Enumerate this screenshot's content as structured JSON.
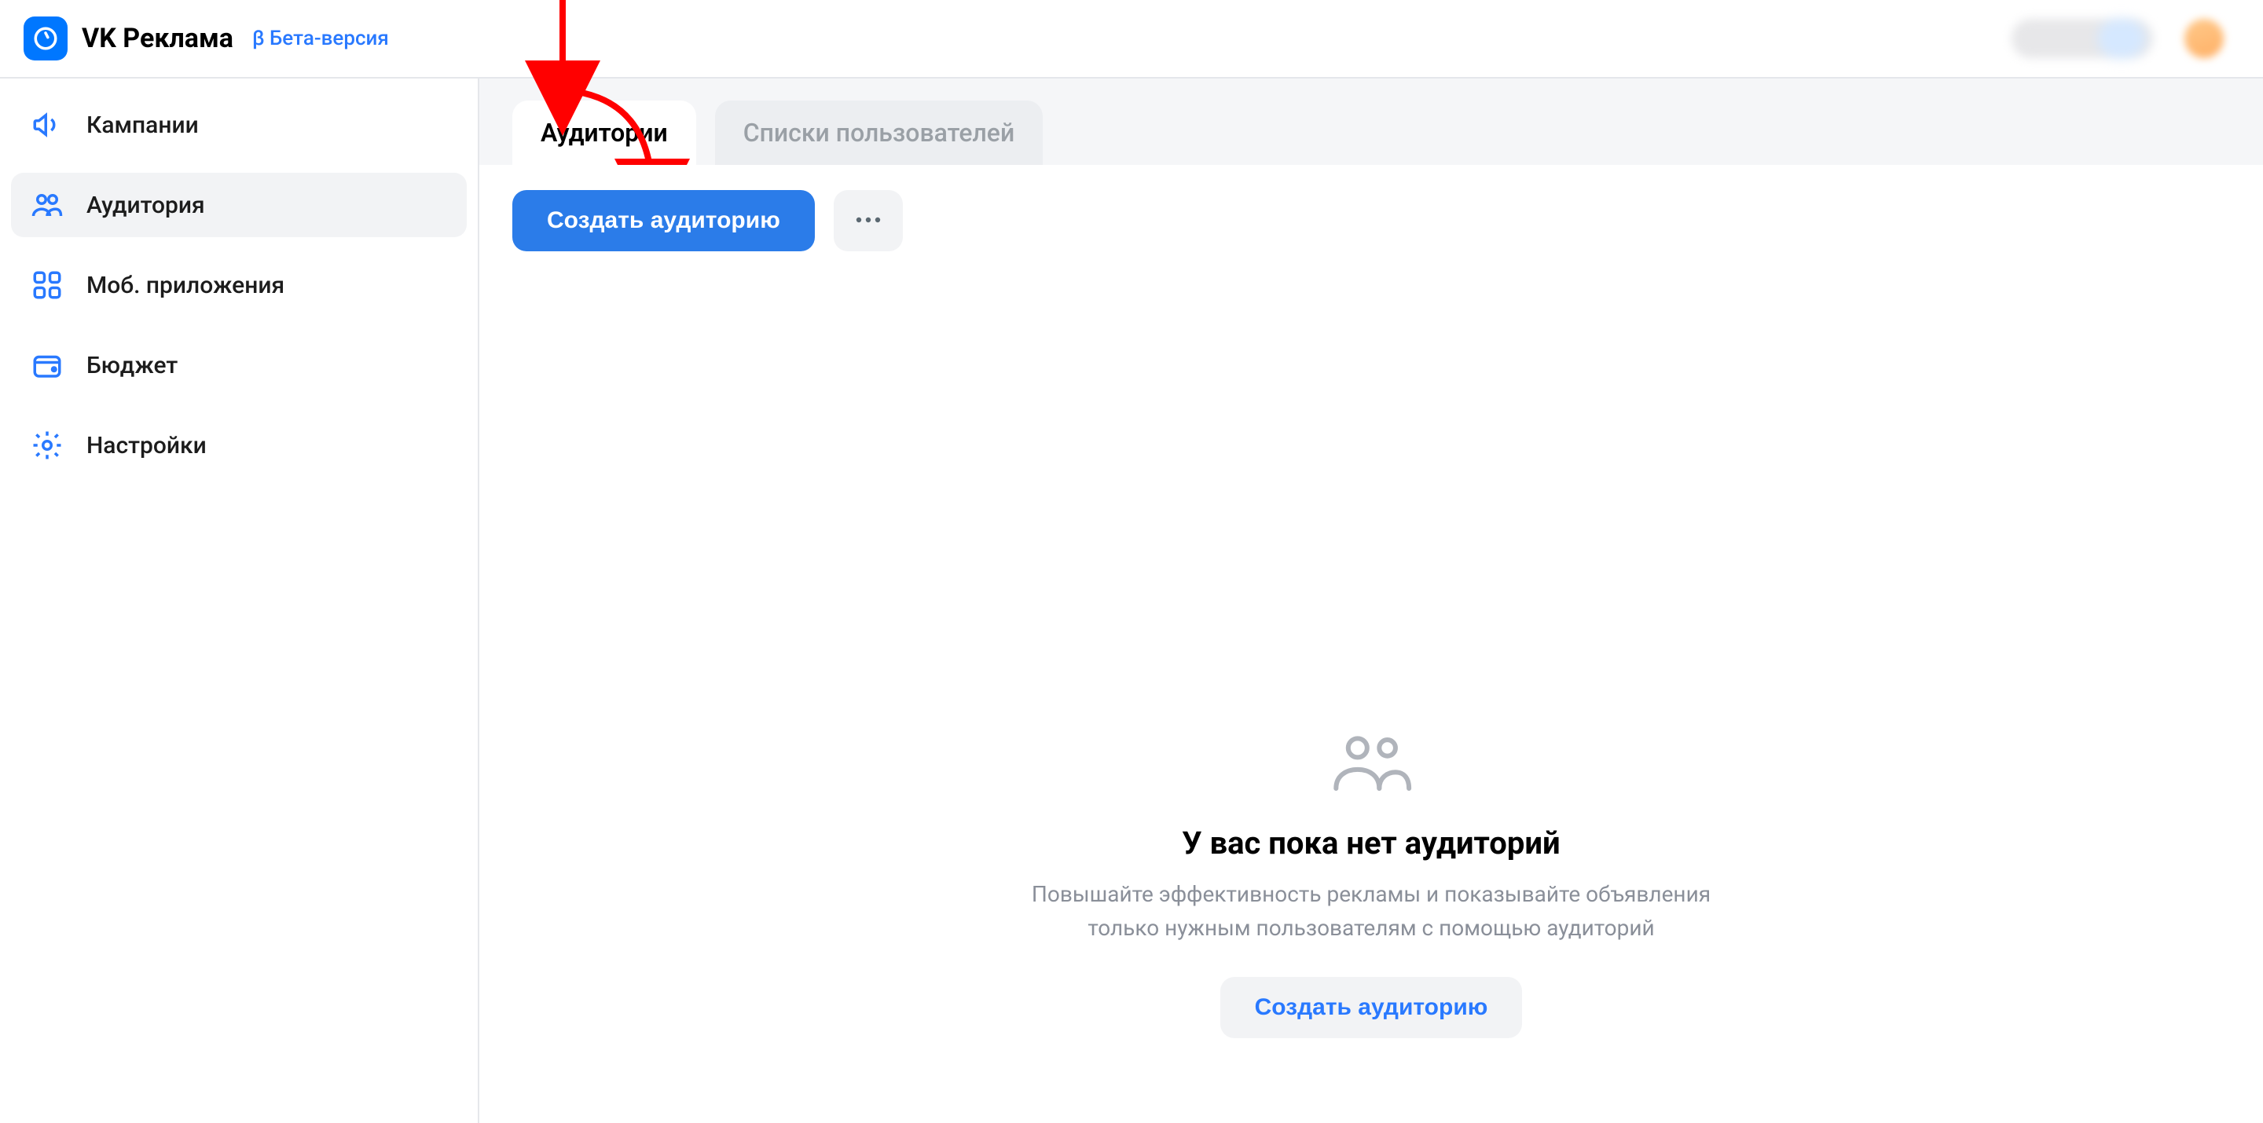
{
  "header": {
    "title": "VK Реклама",
    "beta": "β Бета-версия"
  },
  "sidebar": {
    "items": [
      {
        "id": "campaigns",
        "label": "Кампании",
        "icon": "megaphone-icon"
      },
      {
        "id": "audience",
        "label": "Аудитория",
        "icon": "users-icon",
        "active": true
      },
      {
        "id": "apps",
        "label": "Моб. приложения",
        "icon": "apps-icon"
      },
      {
        "id": "budget",
        "label": "Бюджет",
        "icon": "wallet-icon"
      },
      {
        "id": "settings",
        "label": "Настройки",
        "icon": "gear-icon"
      }
    ]
  },
  "tabs": [
    {
      "id": "audiences",
      "label": "Аудитории",
      "active": true
    },
    {
      "id": "user_lists",
      "label": "Списки пользователей",
      "active": false
    }
  ],
  "toolbar": {
    "create_label": "Создать аудиторию"
  },
  "empty_state": {
    "title": "У вас пока нет аудиторий",
    "desc_line1": "Повышайте эффективность рекламы и показывайте объявления",
    "desc_line2": "только нужным пользователям с помощью аудиторий",
    "cta": "Создать аудиторию"
  }
}
